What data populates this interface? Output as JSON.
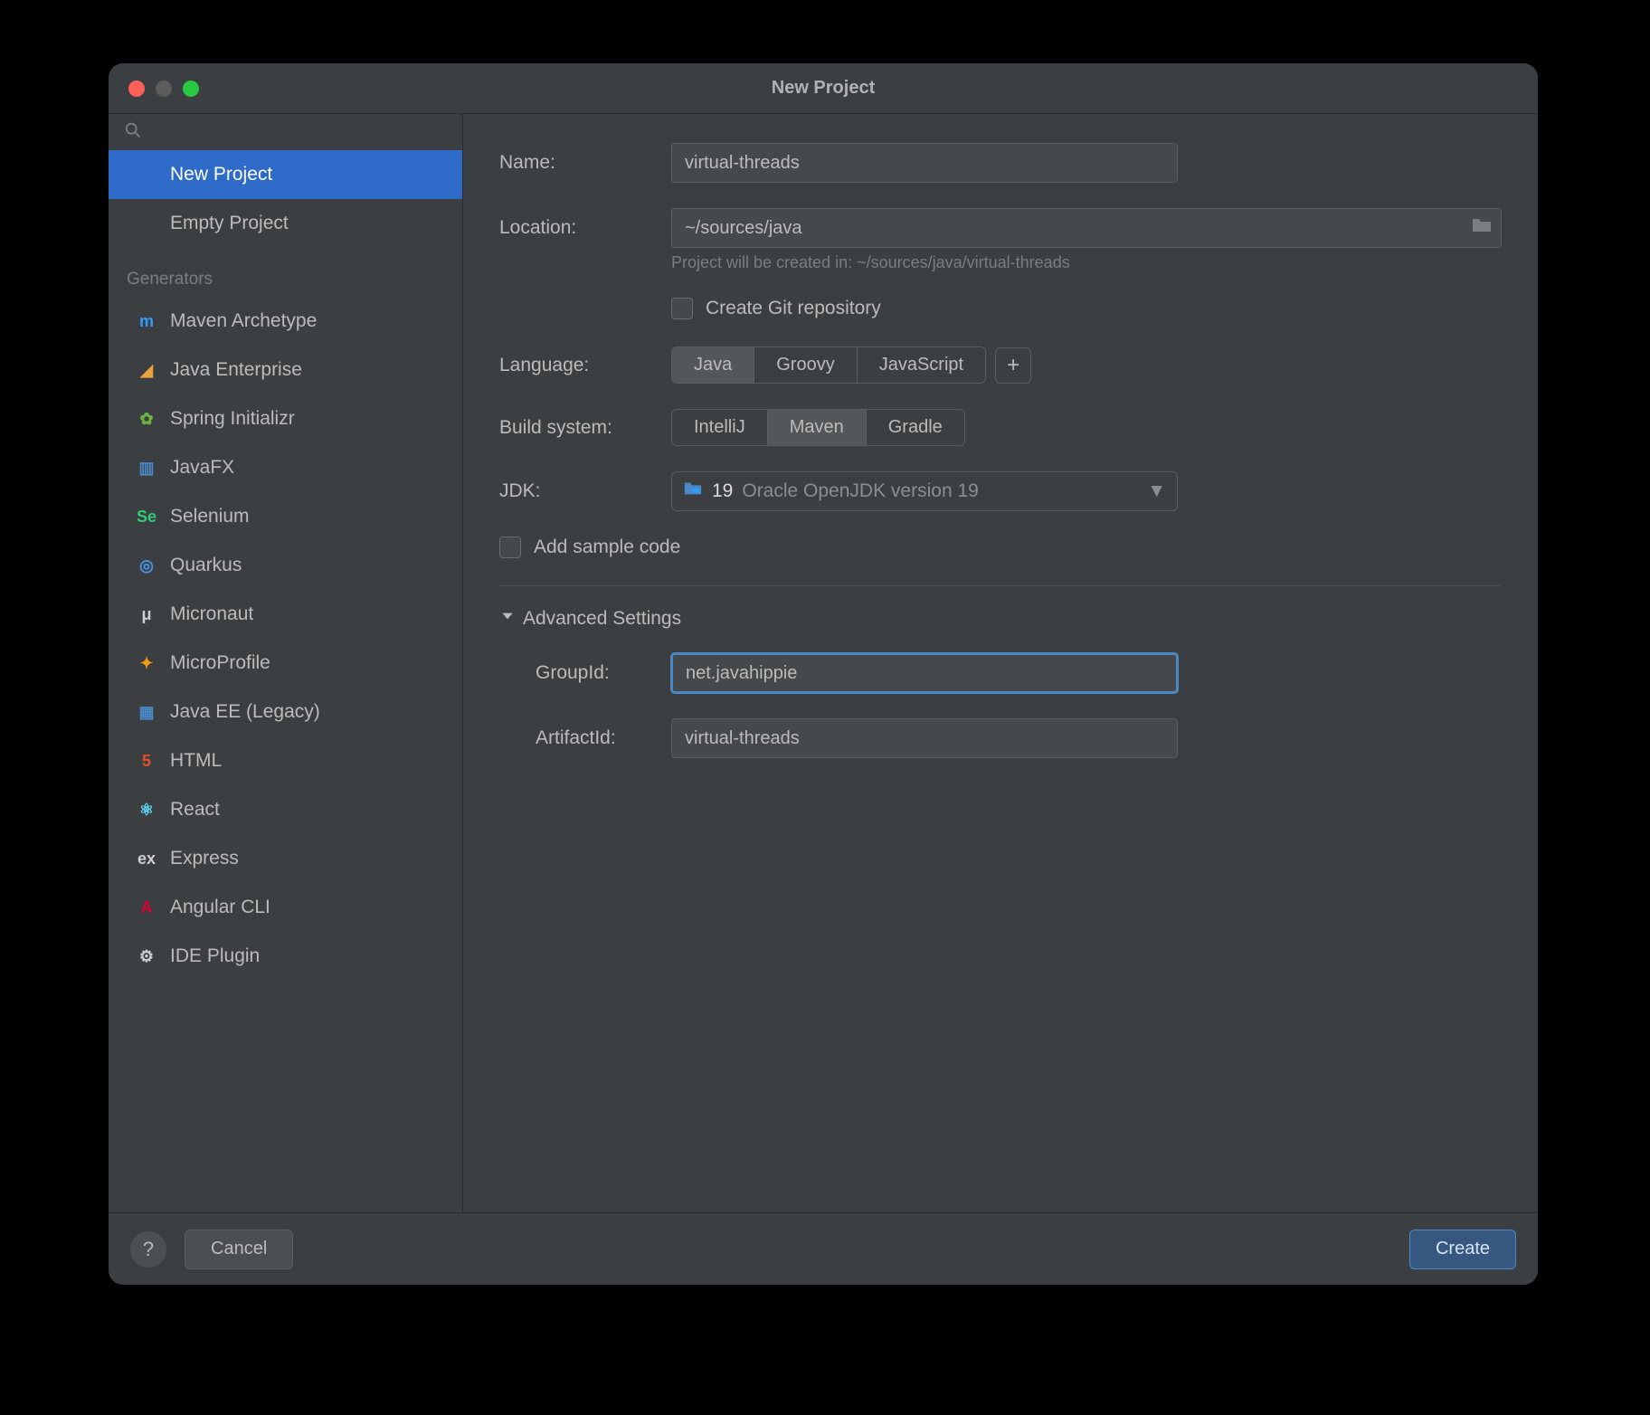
{
  "window": {
    "title": "New Project"
  },
  "sidebar": {
    "search_placeholder": "",
    "items": [
      {
        "label": "New Project",
        "selected": true
      },
      {
        "label": "Empty Project",
        "selected": false
      }
    ],
    "generators_header": "Generators",
    "generators": [
      {
        "label": "Maven Archetype",
        "icon": "m",
        "color": "#2e9eff"
      },
      {
        "label": "Java Enterprise",
        "icon": "◢",
        "color": "#e8a33d"
      },
      {
        "label": "Spring Initializr",
        "icon": "✿",
        "color": "#6db33f"
      },
      {
        "label": "JavaFX",
        "icon": "▥",
        "color": "#4a88c7"
      },
      {
        "label": "Selenium",
        "icon": "Se",
        "color": "#2ecc71"
      },
      {
        "label": "Quarkus",
        "icon": "◎",
        "color": "#4695eb"
      },
      {
        "label": "Micronaut",
        "icon": "μ",
        "color": "#cfcfcf"
      },
      {
        "label": "MicroProfile",
        "icon": "✦",
        "color": "#f39c12"
      },
      {
        "label": "Java EE (Legacy)",
        "icon": "▦",
        "color": "#4a88c7"
      },
      {
        "label": "HTML",
        "icon": "5",
        "color": "#e44d26"
      },
      {
        "label": "React",
        "icon": "⚛",
        "color": "#61dafb"
      },
      {
        "label": "Express",
        "icon": "ex",
        "color": "#cfcfcf"
      },
      {
        "label": "Angular CLI",
        "icon": "A",
        "color": "#dd0031"
      },
      {
        "label": "IDE Plugin",
        "icon": "⚙",
        "color": "#cfcfcf"
      }
    ]
  },
  "form": {
    "name_label": "Name:",
    "name_value": "virtual-threads",
    "location_label": "Location:",
    "location_value": "~/sources/java",
    "location_hint": "Project will be created in: ~/sources/java/virtual-threads",
    "git_label": "Create Git repository",
    "language_label": "Language:",
    "languages": [
      {
        "label": "Java",
        "selected": true
      },
      {
        "label": "Groovy",
        "selected": false
      },
      {
        "label": "JavaScript",
        "selected": false
      }
    ],
    "build_label": "Build system:",
    "builds": [
      {
        "label": "IntelliJ",
        "selected": false
      },
      {
        "label": "Maven",
        "selected": true
      },
      {
        "label": "Gradle",
        "selected": false
      }
    ],
    "jdk_label": "JDK:",
    "jdk_version": "19",
    "jdk_desc": "Oracle OpenJDK version 19",
    "sample_label": "Add sample code",
    "advanced_label": "Advanced Settings",
    "group_label": "GroupId:",
    "group_value": "net.javahippie",
    "artifact_label": "ArtifactId:",
    "artifact_value": "virtual-threads"
  },
  "footer": {
    "help": "?",
    "cancel": "Cancel",
    "create": "Create"
  }
}
